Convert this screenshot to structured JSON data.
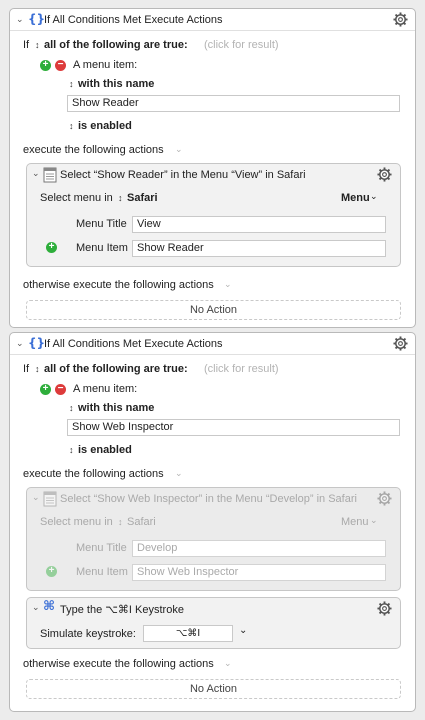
{
  "blocks": [
    {
      "header": {
        "title": "If All Conditions Met Execute Actions"
      },
      "condition": {
        "prefix": "If",
        "quantifier": "all of the following are true:",
        "result_hint": "(click for result)"
      },
      "menu_item": {
        "label": "A menu item:",
        "with_name": "with this name",
        "name_value": "Show Reader",
        "state": "is enabled"
      },
      "execute_label": "execute the following actions",
      "action": {
        "title": "Select “Show Reader” in the Menu “View” in Safari",
        "select_menu_in": "Select menu in",
        "app": "Safari",
        "menu_dropdown": "Menu",
        "menu_title_label": "Menu Title",
        "menu_title_value": "View",
        "menu_item_label": "Menu Item",
        "menu_item_value": "Show Reader"
      },
      "otherwise_label": "otherwise execute the following actions",
      "no_action": "No Action"
    },
    {
      "header": {
        "title": "If All Conditions Met Execute Actions"
      },
      "condition": {
        "prefix": "If",
        "quantifier": "all of the following are true:",
        "result_hint": "(click for result)"
      },
      "menu_item": {
        "label": "A menu item:",
        "with_name": "with this name",
        "name_value": "Show Web Inspector",
        "state": "is enabled"
      },
      "execute_label": "execute the following actions",
      "action": {
        "title": "Select “Show Web Inspector” in the Menu “Develop” in Safari",
        "select_menu_in": "Select menu in",
        "app": "Safari",
        "menu_dropdown": "Menu",
        "menu_title_label": "Menu Title",
        "menu_title_value": "Develop",
        "menu_item_label": "Menu Item",
        "menu_item_value": "Show Web Inspector"
      },
      "keystroke": {
        "title": "Type the ⌥⌘I Keystroke",
        "simulate_label": "Simulate keystroke:",
        "value": "⌥⌘I"
      },
      "otherwise_label": "otherwise execute the following actions",
      "no_action": "No Action"
    }
  ],
  "symbols": {
    "up_down": "↕",
    "chev_down": "˅",
    "plus": "+",
    "minus": "−",
    "chev_small": "⌄",
    "braces": "{}"
  },
  "icons": {
    "gear": "gear-icon",
    "braces": "braces-icon",
    "document": "document-icon",
    "command": "command-key-icon"
  },
  "colors": {
    "braces": "#3b6fd6",
    "green": "#2eae3b",
    "red": "#dd3b3b"
  }
}
